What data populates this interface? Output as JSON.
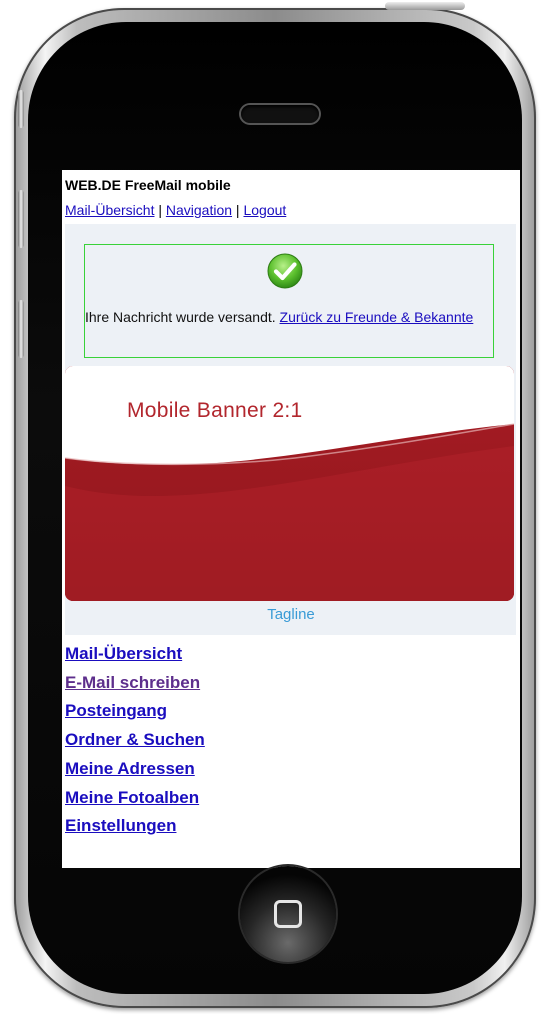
{
  "app": {
    "title": "WEB.DE FreeMail mobile"
  },
  "topnav": {
    "mail_overview": "Mail-Übersicht",
    "sep1": " | ",
    "navigation": "Navigation",
    "sep2": " | ",
    "logout": "Logout"
  },
  "confirmation": {
    "icon": "check-circle-icon",
    "message": "Ihre Nachricht wurde versandt. ",
    "link": "Zurück zu Freunde & Bekannte",
    "border_color": "#39d239"
  },
  "banner": {
    "text": "Mobile Banner 2:1",
    "color": "#a71e25"
  },
  "tagline": "Tagline",
  "menu": {
    "items": [
      {
        "label": "Mail-Übersicht"
      },
      {
        "label": "E-Mail schreiben"
      },
      {
        "label": "Posteingang"
      },
      {
        "label": "Ordner & Suchen"
      },
      {
        "label": "Meine Adressen"
      },
      {
        "label": "Meine Fotoalben"
      },
      {
        "label": "Einstellungen"
      }
    ]
  },
  "colors": {
    "link": "#1a0dbf",
    "visited_link": "#5d2e8c",
    "panel_bg": "#edf1f6"
  }
}
